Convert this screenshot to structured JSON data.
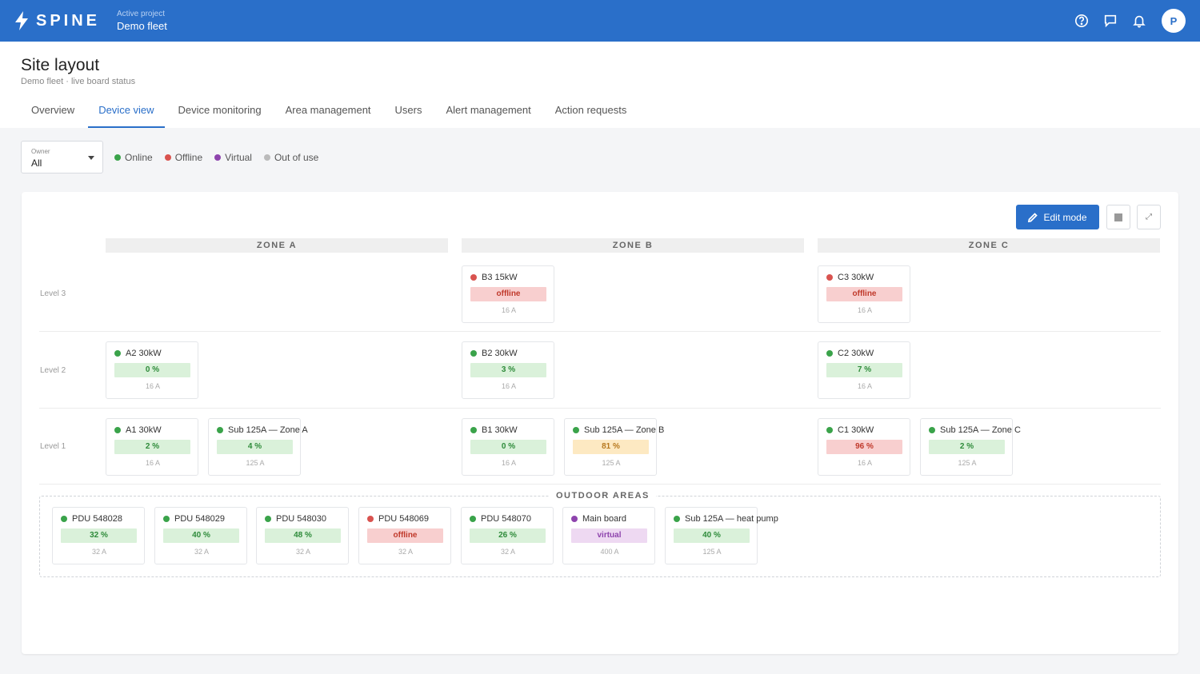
{
  "app": {
    "name": "SPINE",
    "project_label": "Active project",
    "project_name": "Demo fleet",
    "avatar_initial": "P"
  },
  "page": {
    "title": "Site layout",
    "subtitle": "Demo fleet · live board status"
  },
  "tabs": [
    "Overview",
    "Device view",
    "Device monitoring",
    "Area management",
    "Users",
    "Alert management",
    "Action requests"
  ],
  "active_tab": "Device view",
  "filter": {
    "owner_label": "Owner",
    "owner_value": "All"
  },
  "legend": [
    {
      "label": "Online",
      "color": "#3aa34a"
    },
    {
      "label": "Offline",
      "color": "#d9534f"
    },
    {
      "label": "Virtual",
      "color": "#8e44ad"
    },
    {
      "label": "Out of use",
      "color": "#bbbbbb"
    }
  ],
  "toolbar": {
    "edit_mode_label": "Edit mode",
    "expand_glyph": "⤢"
  },
  "zones": [
    "ZONE A",
    "ZONE B",
    "ZONE C"
  ],
  "levels": [
    "Level 3",
    "Level 2",
    "Level 1"
  ],
  "devices": {
    "b3": {
      "name": "B3 15kW",
      "status": "offline",
      "value": "offline",
      "amps": "16 A"
    },
    "c3": {
      "name": "C3 30kW",
      "status": "offline",
      "value": "offline",
      "amps": "16 A"
    },
    "a2": {
      "name": "A2 30kW",
      "status": "online",
      "value": "0 %",
      "amps": "16 A"
    },
    "b2": {
      "name": "B2 30kW",
      "status": "online",
      "value": "3 %",
      "amps": "16 A"
    },
    "c2": {
      "name": "C2 30kW",
      "status": "online",
      "value": "7 %",
      "amps": "16 A"
    },
    "a1": {
      "name": "A1 30kW",
      "status": "online",
      "value": "2 %",
      "amps": "16 A"
    },
    "suba": {
      "name": "Sub 125A — Zone A",
      "status": "online",
      "value": "4 %",
      "amps": "125 A"
    },
    "b1": {
      "name": "B1 30kW",
      "status": "online",
      "value": "0 %",
      "amps": "16 A"
    },
    "subb": {
      "name": "Sub 125A — Zone B",
      "status": "online",
      "value": "81 %",
      "amps": "125 A"
    },
    "c1": {
      "name": "C1 30kW",
      "status": "online",
      "value": "96 %",
      "amps": "16 A"
    },
    "subc": {
      "name": "Sub 125A — Zone C",
      "status": "online",
      "value": "2 %",
      "amps": "125 A"
    }
  },
  "outdoor": {
    "label": "OUTDOOR AREAS",
    "devices": [
      {
        "name": "PDU 548028",
        "status": "online",
        "value": "32 %",
        "amps": "32 A"
      },
      {
        "name": "PDU 548029",
        "status": "online",
        "value": "40 %",
        "amps": "32 A"
      },
      {
        "name": "PDU 548030",
        "status": "online",
        "value": "48 %",
        "amps": "32 A"
      },
      {
        "name": "PDU 548069",
        "status": "offline",
        "value": "offline",
        "amps": "32 A"
      },
      {
        "name": "PDU 548070",
        "status": "online",
        "value": "26 %",
        "amps": "32 A"
      },
      {
        "name": "Main board",
        "status": "virtual",
        "value": "virtual",
        "amps": "400 A"
      },
      {
        "name": "Sub 125A — heat pump",
        "status": "online",
        "value": "40 %",
        "amps": "125 A"
      }
    ]
  }
}
